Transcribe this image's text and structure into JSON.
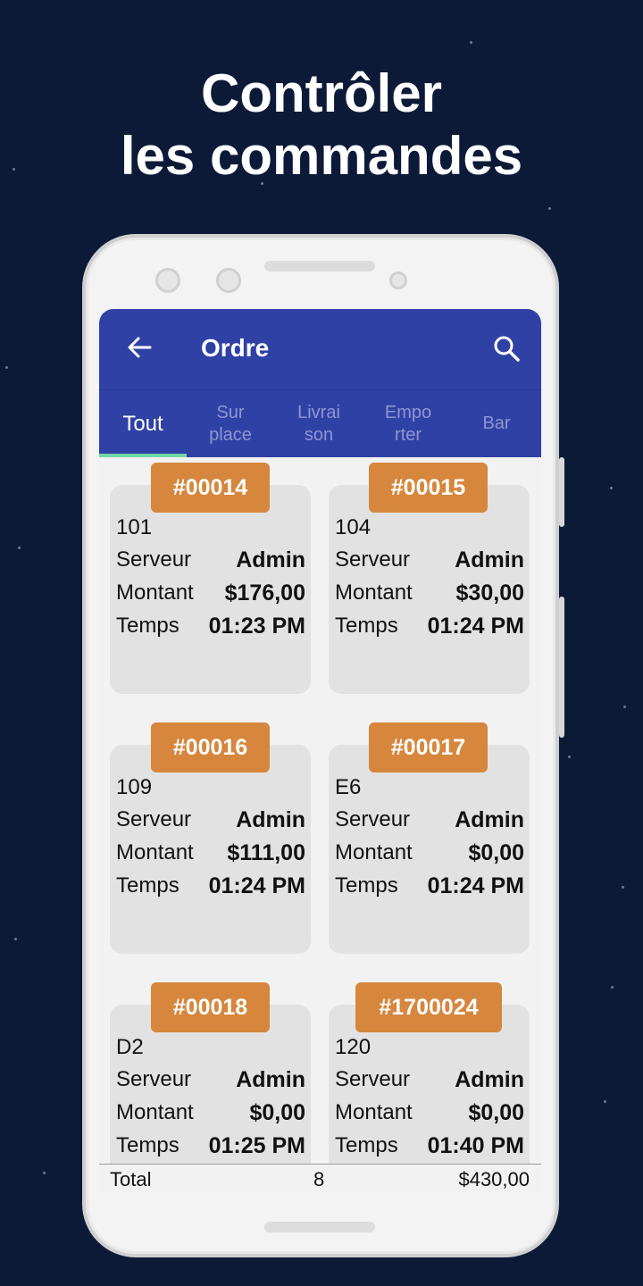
{
  "headline": {
    "line1": "Contrôler",
    "line2": "les commandes"
  },
  "appbar": {
    "title": "Ordre",
    "back_icon": "arrow-back-icon",
    "search_icon": "search-icon"
  },
  "tabs": [
    {
      "label": "Tout",
      "active": true
    },
    {
      "label": "Sur\nplace",
      "active": false
    },
    {
      "label": "Livrai\nson",
      "active": false
    },
    {
      "label": "Empo\nrter",
      "active": false
    },
    {
      "label": "Bar",
      "active": false
    }
  ],
  "orders": [
    {
      "number": "#00014",
      "table": "101",
      "server_label": "Serveur",
      "server": "Admin",
      "amount_label": "Montant",
      "amount": "$176,00",
      "time_label": "Temps",
      "time": "01:23 PM"
    },
    {
      "number": "#00015",
      "table": "104",
      "server_label": "Serveur",
      "server": "Admin",
      "amount_label": "Montant",
      "amount": "$30,00",
      "time_label": "Temps",
      "time": "01:24 PM"
    },
    {
      "number": "#00016",
      "table": "109",
      "server_label": "Serveur",
      "server": "Admin",
      "amount_label": "Montant",
      "amount": "$111,00",
      "time_label": "Temps",
      "time": "01:24 PM"
    },
    {
      "number": "#00017",
      "table": "E6",
      "server_label": "Serveur",
      "server": "Admin",
      "amount_label": "Montant",
      "amount": "$0,00",
      "time_label": "Temps",
      "time": "01:24 PM"
    },
    {
      "number": "#00018",
      "table": "D2",
      "server_label": "Serveur",
      "server": "Admin",
      "amount_label": "Montant",
      "amount": "$0,00",
      "time_label": "Temps",
      "time": "01:25 PM"
    },
    {
      "number": "#1700024",
      "table": "120",
      "server_label": "Serveur",
      "server": "Admin",
      "amount_label": "Montant",
      "amount": "$0,00",
      "time_label": "Temps",
      "time": "01:40 PM"
    }
  ],
  "footer": {
    "label": "Total",
    "count": "8",
    "amount": "$430,00"
  },
  "colors": {
    "background": "#0c1a38",
    "appbar": "#3041a6",
    "badge": "#d6873d",
    "tab_indicator": "#6fd6a6",
    "card": "#e2e2e2"
  }
}
